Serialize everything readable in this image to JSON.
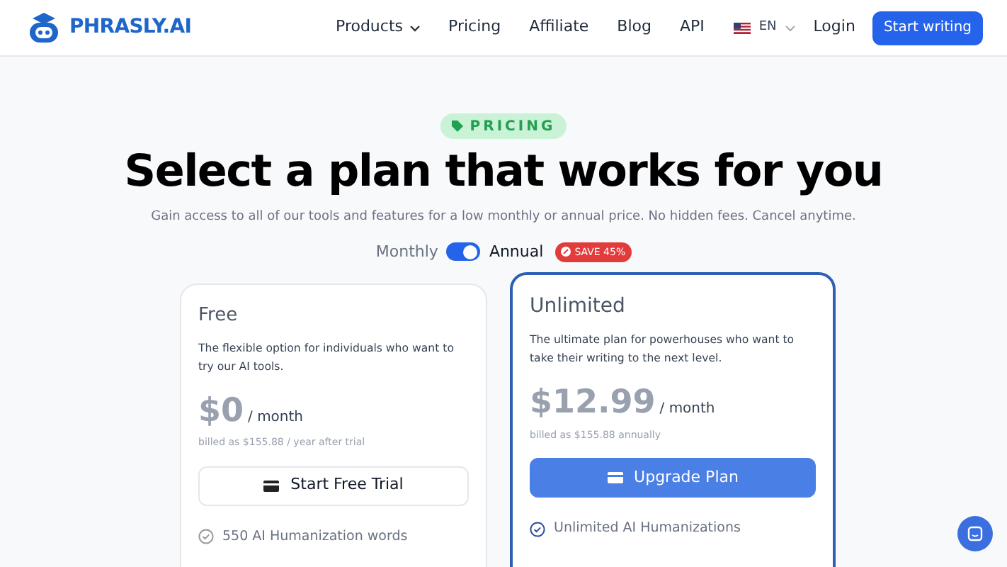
{
  "nav": {
    "logo": "PHRASLY.AI",
    "links": [
      {
        "label": "Products",
        "dropdown": true
      },
      {
        "label": "Pricing",
        "dropdown": false
      },
      {
        "label": "Affiliate",
        "dropdown": false
      },
      {
        "label": "Blog",
        "dropdown": false
      },
      {
        "label": "API",
        "dropdown": false
      }
    ],
    "language": "EN",
    "login": "Login",
    "cta": "Start writing"
  },
  "hero": {
    "badge": "PRICING",
    "title": "Select a plan that works for you",
    "subtitle": "Gain access to all of our tools and features for a low monthly or annual price. No hidden fees. Cancel anytime."
  },
  "billing": {
    "monthly": "Monthly",
    "annual": "Annual",
    "annual_on": true,
    "save": "SAVE 45%"
  },
  "plans": [
    {
      "name": "Free",
      "featured": false,
      "description": "The flexible option for individuals who want to try our AI tools.",
      "price": "$0",
      "period": "/ month",
      "billed": "billed as $155.88 / year after trial",
      "button": "Start Free Trial",
      "features": [
        "550 AI Humanization words"
      ]
    },
    {
      "name": "Unlimited",
      "featured": true,
      "description": "The ultimate plan for powerhouses who want to take their writing to the next level.",
      "price": "$12.99",
      "period": "/ month",
      "billed": "billed as $155.88 annually",
      "button": "Upgrade Plan",
      "features": [
        "Unlimited AI Humanizations"
      ]
    }
  ]
}
